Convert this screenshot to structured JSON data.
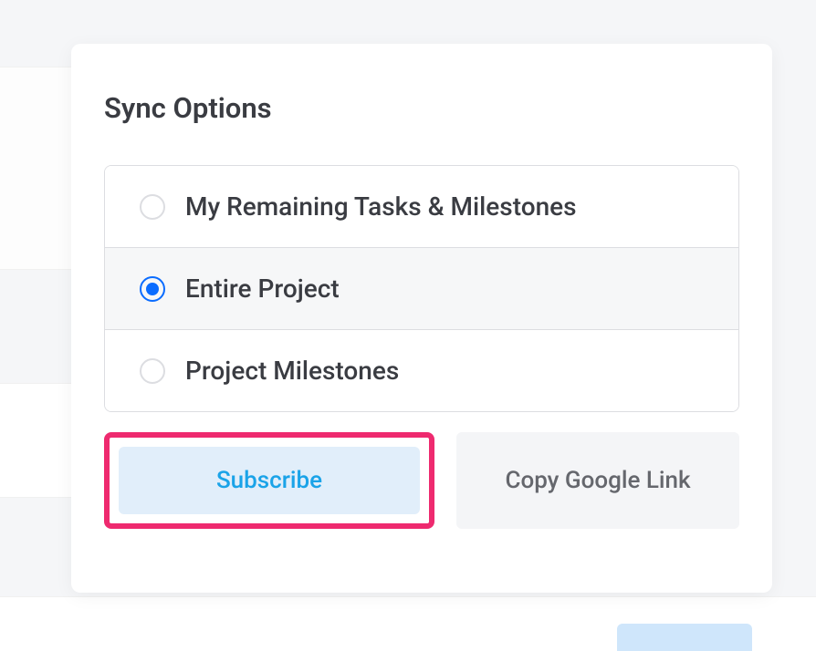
{
  "modal": {
    "title": "Sync Options",
    "options": [
      {
        "label": "My Remaining Tasks & Milestones",
        "selected": false
      },
      {
        "label": "Entire Project",
        "selected": true
      },
      {
        "label": "Project Milestones",
        "selected": false
      }
    ],
    "buttons": {
      "subscribe": "Subscribe",
      "copy_link": "Copy Google Link"
    }
  }
}
